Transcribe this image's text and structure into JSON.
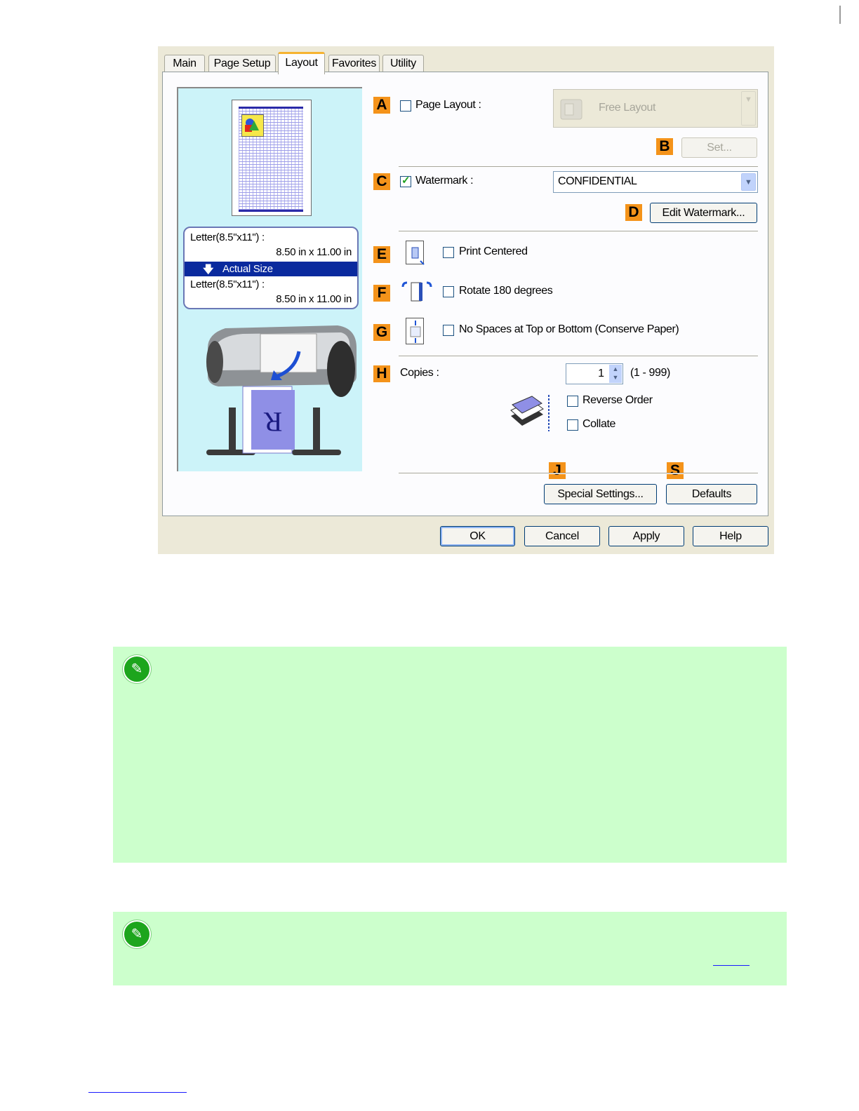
{
  "dialog": {
    "tabs": [
      "Main",
      "Page Setup",
      "Layout",
      "Favorites",
      "Utility"
    ],
    "active_tab": "Layout",
    "preview": {
      "source_size": "Letter(8.5\"x11\") :",
      "source_dims": "8.50 in x 11.00 in",
      "scaling": "Actual Size",
      "output_size": "Letter(8.5\"x11\") :",
      "output_dims": "8.50 in x 11.00 in",
      "printer_letter": "R"
    },
    "badges": {
      "a": "A",
      "b": "B",
      "c": "C",
      "d": "D",
      "e": "E",
      "f": "F",
      "g": "G",
      "h": "H",
      "j": "J",
      "s": "S"
    },
    "page_layout": {
      "label": "Page Layout :",
      "checked": false,
      "value": "Free Layout",
      "set_button": "Set..."
    },
    "watermark": {
      "label": "Watermark :",
      "checked": true,
      "value": "CONFIDENTIAL",
      "edit_button": "Edit Watermark..."
    },
    "print_centered": {
      "label": "Print Centered",
      "checked": false
    },
    "rotate": {
      "label": "Rotate 180 degrees",
      "checked": false
    },
    "no_spaces": {
      "label": "No Spaces at Top or Bottom (Conserve Paper)",
      "checked": false
    },
    "copies": {
      "label": "Copies :",
      "value": "1",
      "range": "(1 - 999)"
    },
    "reverse_order": {
      "label": "Reverse Order",
      "checked": false
    },
    "collate": {
      "label": "Collate",
      "checked": false
    },
    "special_settings_button": "Special Settings...",
    "defaults_button": "Defaults",
    "footer": {
      "ok": "OK",
      "cancel": "Cancel",
      "apply": "Apply",
      "help": "Help"
    }
  },
  "notes": {
    "icon_note_1": "pencil-note-icon",
    "icon_note_2": "pencil-note-icon"
  },
  "colors": {
    "badge": "#f4931a",
    "note_bg": "#ccffcc",
    "preview_bg": "#ccf3f9",
    "active_tab_accent": "#f6b330"
  }
}
